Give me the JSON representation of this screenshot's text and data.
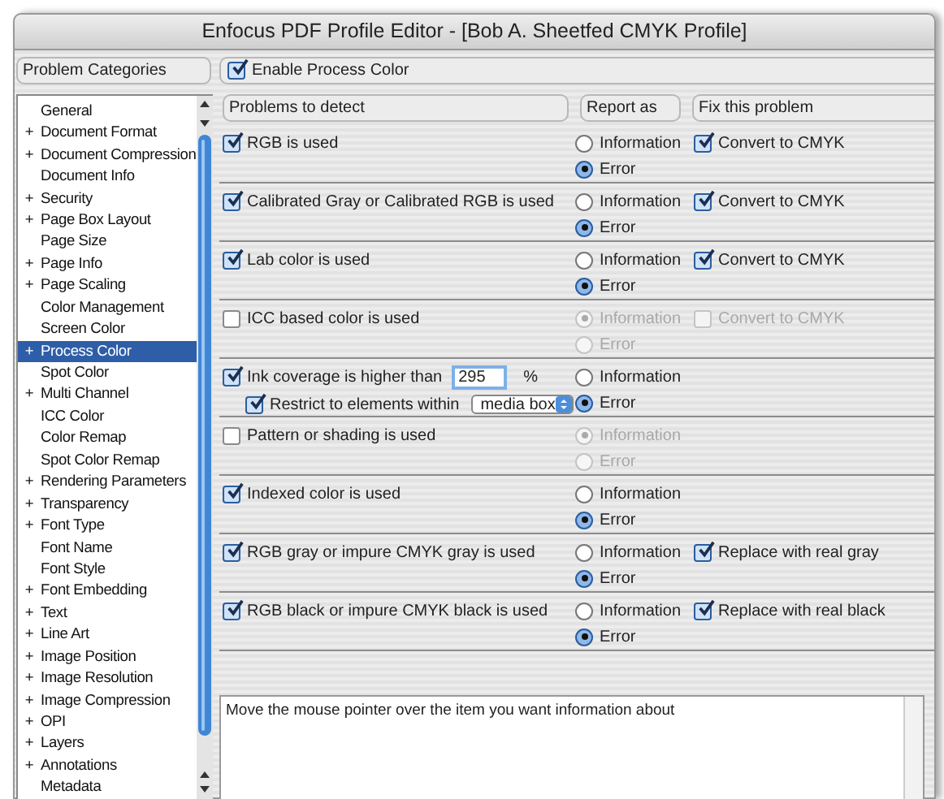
{
  "window": {
    "title": "Enfocus PDF Profile Editor - [Bob A. Sheetfed CMYK Profile]"
  },
  "sidebar": {
    "header": "Problem Categories",
    "items": [
      {
        "label": "General",
        "selected": false
      },
      {
        "label": "Document Format",
        "marker": "+",
        "selected": false
      },
      {
        "label": "Document Compression",
        "marker": "+",
        "selected": false
      },
      {
        "label": "Document Info",
        "selected": false
      },
      {
        "label": "Security",
        "marker": "+",
        "selected": false
      },
      {
        "label": "Page Box Layout",
        "marker": "+",
        "selected": false
      },
      {
        "label": "Page Size",
        "selected": false
      },
      {
        "label": "Page Info",
        "marker": "+",
        "selected": false
      },
      {
        "label": "Page Scaling",
        "marker": "+",
        "selected": false
      },
      {
        "label": "Color Management",
        "selected": false
      },
      {
        "label": "Screen Color",
        "selected": false
      },
      {
        "label": "Process Color",
        "marker": "+",
        "selected": true
      },
      {
        "label": "Spot Color",
        "selected": false
      },
      {
        "label": "Multi Channel",
        "marker": "+",
        "selected": false
      },
      {
        "label": "ICC Color",
        "selected": false
      },
      {
        "label": "Color Remap",
        "selected": false
      },
      {
        "label": "Spot Color Remap",
        "selected": false
      },
      {
        "label": "Rendering Parameters",
        "marker": "+",
        "selected": false
      },
      {
        "label": "Transparency",
        "marker": "+",
        "selected": false
      },
      {
        "label": "Font Type",
        "marker": "+",
        "selected": false
      },
      {
        "label": "Font Name",
        "selected": false
      },
      {
        "label": "Font Style",
        "selected": false
      },
      {
        "label": "Font Embedding",
        "marker": "+",
        "selected": false
      },
      {
        "label": "Text",
        "marker": "+",
        "selected": false
      },
      {
        "label": "Line Art",
        "marker": "+",
        "selected": false
      },
      {
        "label": "Image Position",
        "marker": "+",
        "selected": false
      },
      {
        "label": "Image Resolution",
        "marker": "+",
        "selected": false
      },
      {
        "label": "Image Compression",
        "marker": "+",
        "selected": false
      },
      {
        "label": "OPI",
        "marker": "+",
        "selected": false
      },
      {
        "label": "Layers",
        "marker": "+",
        "selected": false
      },
      {
        "label": "Annotations",
        "marker": "+",
        "selected": false
      },
      {
        "label": "Metadata",
        "selected": false
      }
    ]
  },
  "enable": {
    "label": "Enable Process Color",
    "checked": true
  },
  "columns": [
    "Problems to detect",
    "Report as",
    "Fix this problem"
  ],
  "rows": [
    {
      "kind": "check",
      "label": "RGB is used",
      "checked": true,
      "report": [
        {
          "label": "Information",
          "selected": false,
          "disabled": false
        },
        {
          "label": "Error",
          "selected": true,
          "disabled": false
        }
      ],
      "fix": {
        "label": "Convert to CMYK",
        "checked": true,
        "disabled": false
      }
    },
    {
      "kind": "check",
      "label": "Calibrated Gray or Calibrated RGB is used",
      "checked": true,
      "report": [
        {
          "label": "Information",
          "selected": false,
          "disabled": false
        },
        {
          "label": "Error",
          "selected": true,
          "disabled": false
        }
      ],
      "fix": {
        "label": "Convert to CMYK",
        "checked": true,
        "disabled": false
      }
    },
    {
      "kind": "check",
      "label": "Lab color is used",
      "checked": true,
      "report": [
        {
          "label": "Information",
          "selected": false,
          "disabled": false
        },
        {
          "label": "Error",
          "selected": true,
          "disabled": false
        }
      ],
      "fix": {
        "label": "Convert to CMYK",
        "checked": true,
        "disabled": false
      }
    },
    {
      "kind": "check",
      "label": "ICC based color is used",
      "checked": false,
      "report": [
        {
          "label": "Information",
          "selected": true,
          "disabled": true
        },
        {
          "label": "Error",
          "selected": false,
          "disabled": true
        }
      ],
      "fix": {
        "label": "Convert to CMYK",
        "checked": false,
        "disabled": true
      }
    },
    {
      "kind": "threshold",
      "label": "Ink coverage is higher than",
      "checked": true,
      "value": "295",
      "unit": "%",
      "restrict": {
        "label": "Restrict to elements within",
        "checked": true
      },
      "select": "media box",
      "report": [
        {
          "label": "Information",
          "selected": false,
          "disabled": false
        },
        {
          "label": "Error",
          "selected": true,
          "disabled": false
        }
      ]
    },
    {
      "kind": "check",
      "label": "Pattern or shading is used",
      "checked": false,
      "report": [
        {
          "label": "Information",
          "selected": true,
          "disabled": true
        },
        {
          "label": "Error",
          "selected": false,
          "disabled": true
        }
      ]
    },
    {
      "kind": "check",
      "label": "Indexed color is used",
      "checked": true,
      "report": [
        {
          "label": "Information",
          "selected": false,
          "disabled": false
        },
        {
          "label": "Error",
          "selected": true,
          "disabled": false
        }
      ]
    },
    {
      "kind": "check",
      "label": "RGB gray or impure CMYK gray is used",
      "checked": true,
      "report": [
        {
          "label": "Information",
          "selected": false,
          "disabled": false
        },
        {
          "label": "Error",
          "selected": true,
          "disabled": false
        }
      ],
      "fix": {
        "label": "Replace with real gray",
        "checked": true,
        "disabled": false
      }
    },
    {
      "kind": "check",
      "label": "RGB black or impure CMYK black is used",
      "checked": true,
      "report": [
        {
          "label": "Information",
          "selected": false,
          "disabled": false
        },
        {
          "label": "Error",
          "selected": true,
          "disabled": false
        }
      ],
      "fix": {
        "label": "Replace with real black",
        "checked": true,
        "disabled": false
      }
    }
  ],
  "info": {
    "text": "Move the mouse pointer over the item you want information about"
  }
}
